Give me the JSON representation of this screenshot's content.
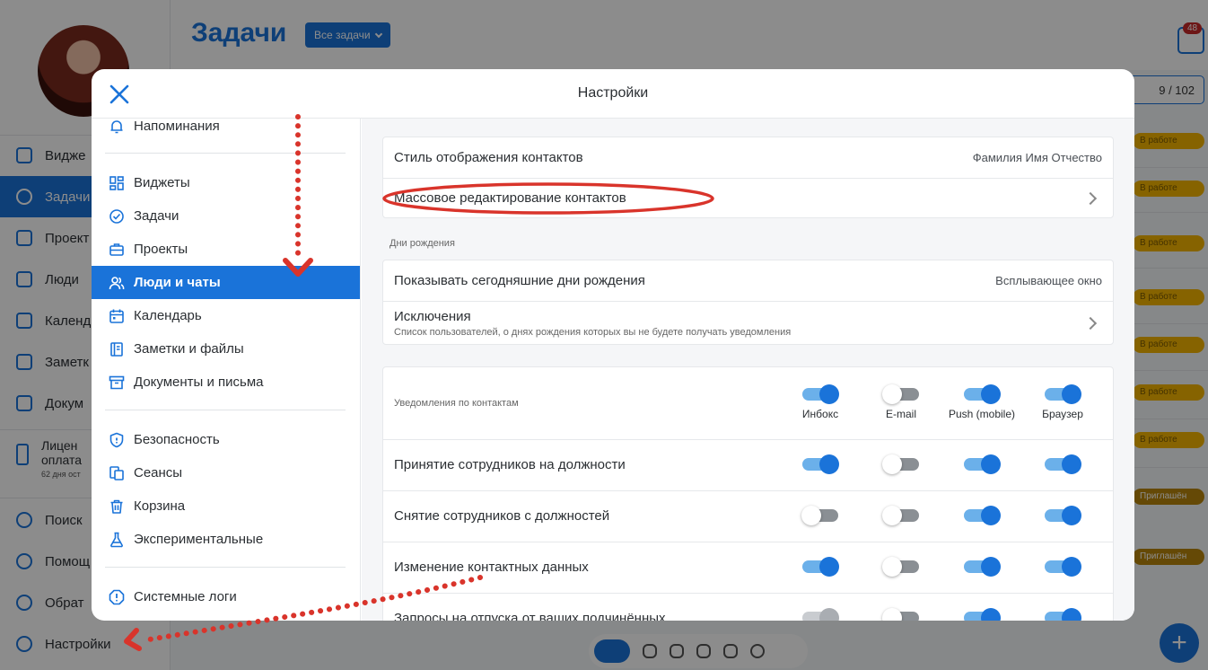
{
  "background": {
    "page_title": "Задачи",
    "filter_label": "Все задачи",
    "inbox_count": "48",
    "task_counter": "9 / 102",
    "nav": [
      "Видже",
      "Задачи",
      "Проект",
      "Люди",
      "Календ",
      "Заметк",
      "Докум",
      "Поиск",
      "Помощ",
      "Обрат",
      "Настройки"
    ],
    "license_line1": "Лицен",
    "license_line2": "оплата",
    "license_sub": "62 дня ост",
    "status_in_work": "В работе",
    "status_invited": "Приглашён"
  },
  "modal": {
    "title": "Настройки",
    "menu": {
      "reminders": "Напоминания",
      "widgets": "Виджеты",
      "tasks": "Задачи",
      "projects": "Проекты",
      "people": "Люди и чаты",
      "calendar": "Календарь",
      "notes": "Заметки и файлы",
      "documents": "Документы и письма",
      "security": "Безопасность",
      "sessions": "Сеансы",
      "trash": "Корзина",
      "experimental": "Экспериментальные",
      "syslogs": "Системные логи"
    },
    "contacts": {
      "display_style_label": "Стиль отображения контактов",
      "display_style_value": "Фамилия Имя Отчество",
      "mass_edit_label": "Массовое редактирование контактов"
    },
    "birthdays": {
      "section": "Дни рождения",
      "show_today_label": "Показывать сегодняшние дни рождения",
      "show_today_value": "Всплывающее окно",
      "exceptions_label": "Исключения",
      "exceptions_sub": "Список пользователей, о днях рождения которых вы не будете получать уведомления"
    },
    "notifications": {
      "header": "Уведомления по контактам",
      "columns": [
        "Инбокс",
        "E-mail",
        "Push (mobile)",
        "Браузер"
      ],
      "header_states": [
        "on",
        "off",
        "on",
        "on"
      ],
      "rows": [
        {
          "label": "Принятие сотрудников на должности",
          "states": [
            "on",
            "off",
            "on",
            "on"
          ]
        },
        {
          "label": "Снятие сотрудников с должностей",
          "states": [
            "off",
            "off",
            "on",
            "on"
          ]
        },
        {
          "label": "Изменение контактных данных",
          "states": [
            "on",
            "off",
            "on",
            "on"
          ]
        },
        {
          "label": "Запросы на отпуска от ваших подчинённых",
          "states": [
            "disabled",
            "off",
            "on",
            "on"
          ]
        }
      ]
    }
  },
  "colors": {
    "accent": "#1a73d9",
    "annotation": "#d9342b"
  }
}
